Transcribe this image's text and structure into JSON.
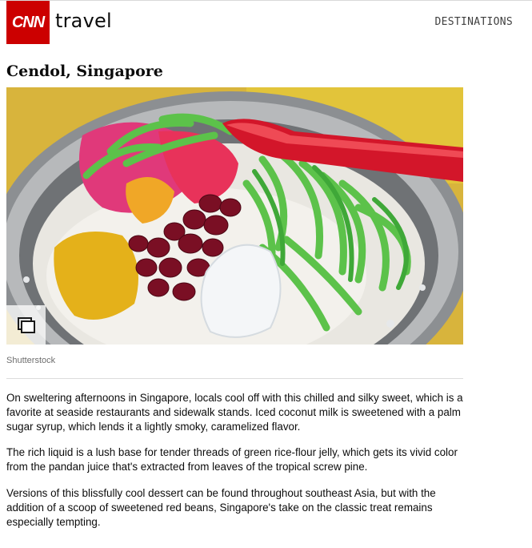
{
  "header": {
    "logo_text": "CNN",
    "section": "travel",
    "nav_link": "DESTINATIONS"
  },
  "article": {
    "title": "Cendol, Singapore",
    "image_credit": "Shutterstock",
    "paragraphs": [
      "On sweltering afternoons in Singapore, locals cool off with this chilled and silky sweet, which is a favorite at seaside restaurants and sidewalk stands. Iced coconut milk is sweetened with a palm sugar syrup, which lends it a lightly smoky, caramelized flavor.",
      "The rich liquid is a lush base for tender threads of green rice-flour jelly, which gets its vivid color from the pandan juice that's extracted from leaves of the tropical screw pine.",
      "Versions of this blissfully cool dessert can be found throughout southeast Asia, but with the addition of a scoop of sweetened red beans, Singapore's take on the classic treat remains especially tempting."
    ]
  },
  "icons": {
    "gallery": "gallery-icon"
  },
  "colors": {
    "brand_red": "#cc0000",
    "text": "#0c0c0c",
    "muted": "#6e6e6e"
  }
}
